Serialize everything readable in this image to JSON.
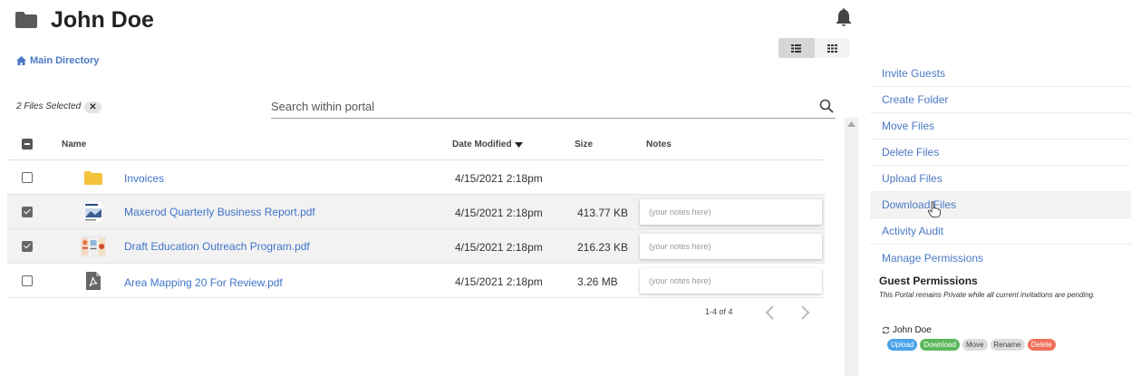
{
  "header": {
    "title": "John Doe"
  },
  "breadcrumb": {
    "label": "Main Directory"
  },
  "selection": {
    "label": "2 Files Selected",
    "clear_label": "✕"
  },
  "search": {
    "placeholder": "Search within portal",
    "value": ""
  },
  "table": {
    "columns": {
      "name": "Name",
      "date_modified": "Date Modified",
      "size": "Size",
      "notes": "Notes"
    },
    "sort": "date_modified-desc",
    "rows": [
      {
        "name": "Invoices",
        "date": "4/15/2021 2:18pm",
        "size": "",
        "type": "folder",
        "checked": false,
        "notes_placeholder": ""
      },
      {
        "name": "Maxerod Quarterly Business Report.pdf",
        "date": "4/15/2021 2:18pm",
        "size": "413.77 KB",
        "type": "report-thumb",
        "checked": true,
        "notes_placeholder": "(your notes here)"
      },
      {
        "name": "Draft Education Outreach Program.pdf",
        "date": "4/15/2021 2:18pm",
        "size": "216.23 KB",
        "type": "brochure-thumb",
        "checked": true,
        "notes_placeholder": "(your notes here)"
      },
      {
        "name": "Area Mapping 20 For Review.pdf",
        "date": "4/15/2021 2:18pm",
        "size": "3.26 MB",
        "type": "pdf-icon",
        "checked": false,
        "notes_placeholder": "(your notes here)"
      }
    ]
  },
  "pagination": {
    "label": "1-4 of 4"
  },
  "actions": [
    {
      "label": "Invite Guests"
    },
    {
      "label": "Create Folder"
    },
    {
      "label": "Move Files"
    },
    {
      "label": "Delete Files"
    },
    {
      "label": "Upload Files"
    },
    {
      "label": "Download Files"
    },
    {
      "label": "Activity Audit"
    },
    {
      "label": "Manage Permissions"
    }
  ],
  "guest_permissions": {
    "title": "Guest Permissions",
    "note": "This Portal remains Private while all current invitations are pending.",
    "guest": {
      "name": "John Doe",
      "permissions": [
        {
          "label": "Upload",
          "enabled": true,
          "color": "#4aa3e8"
        },
        {
          "label": "Download",
          "enabled": true,
          "color": "#5cb85c"
        },
        {
          "label": "Move",
          "enabled": false,
          "color": "#dcdcdc"
        },
        {
          "label": "Rename",
          "enabled": false,
          "color": "#dcdcdc"
        },
        {
          "label": "Delete",
          "enabled": true,
          "color": "#f0705a"
        }
      ]
    }
  },
  "colors": {
    "link": "#4a78c4",
    "folder": "#f5c33b",
    "row_selected": "#f2f2f2"
  }
}
